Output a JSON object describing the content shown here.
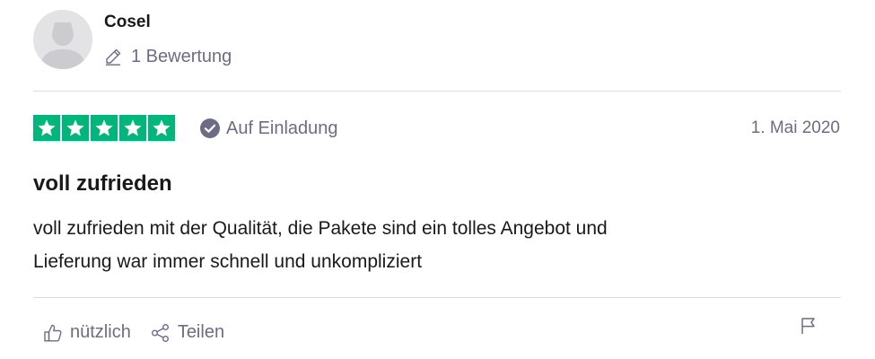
{
  "reviewer": {
    "name": "Cosel",
    "review_count": "1 Bewertung"
  },
  "rating": {
    "stars": 5,
    "max_stars": 5,
    "color": "#00b67a"
  },
  "badge": {
    "label": "Auf Einladung"
  },
  "date": "1. Mai 2020",
  "review": {
    "title": "voll zufrieden",
    "body_lines": [
      "voll zufrieden mit der Qualität, die Pakete sind ein tolles Angebot und",
      "Lieferung war immer schnell und unkompliziert"
    ]
  },
  "actions": {
    "useful_label": "nützlich",
    "share_label": "Teilen"
  },
  "icons": {
    "avatar": "user-silhouette-icon",
    "pen": "pen-icon",
    "star": "star-icon",
    "check": "check-circle-icon",
    "thumbs_up": "thumbs-up-icon",
    "share": "share-icon",
    "flag": "flag-icon"
  },
  "colors": {
    "text_primary": "#191919",
    "text_secondary": "#6c6c85",
    "divider": "#dcdce6",
    "avatar_bg": "#e3e3e5"
  }
}
